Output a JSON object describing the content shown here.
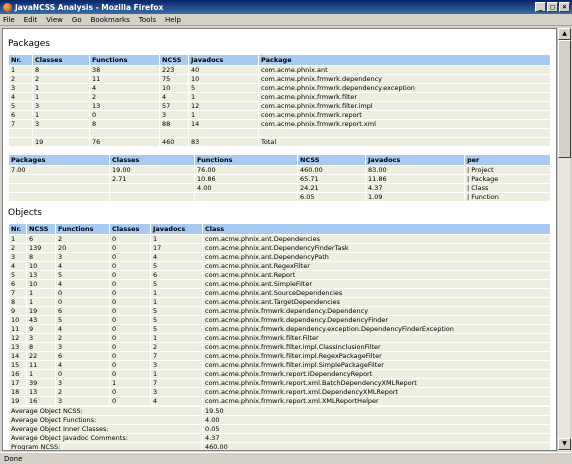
{
  "window": {
    "title": "JavaNCSS Analysis - Mozilla Firefox",
    "minimize": "_",
    "maximize": "□",
    "close": "×"
  },
  "menu": [
    "File",
    "Edit",
    "View",
    "Go",
    "Bookmarks",
    "Tools",
    "Help"
  ],
  "status": "Done",
  "packages": {
    "heading": "Packages",
    "columns": [
      "Nr.",
      "Classes",
      "Functions",
      "NCSS",
      "Javadocs",
      "Package"
    ],
    "rows": [
      [
        "1",
        "8",
        "38",
        "223",
        "40",
        "com.acme.phnix.ant"
      ],
      [
        "2",
        "2",
        "11",
        "75",
        "10",
        "com.acme.phnix.frmwrk.dependency"
      ],
      [
        "3",
        "1",
        "4",
        "10",
        "5",
        "com.acme.phnix.frmwrk.dependency.exception"
      ],
      [
        "4",
        "1",
        "2",
        "4",
        "1",
        "com.acme.phnix.frmwrk.filter"
      ],
      [
        "5",
        "3",
        "13",
        "57",
        "12",
        "com.acme.phnix.frmwrk.filter.impl"
      ],
      [
        "6",
        "1",
        "0",
        "3",
        "1",
        "com.acme.phnix.frmwrk.report"
      ],
      [
        "7",
        "3",
        "8",
        "88",
        "14",
        "com.acme.phnix.frmwrk.report.xml"
      ]
    ],
    "total": [
      "",
      "19",
      "76",
      "460",
      "83",
      "Total"
    ]
  },
  "averages": {
    "columns": [
      "Packages",
      "Classes",
      "Functions",
      "NCSS",
      "Javadocs",
      "per"
    ],
    "rows": [
      [
        "7.00",
        "19.00",
        "76.00",
        "460.00",
        "83.00",
        "Project"
      ],
      [
        "",
        "2.71",
        "10.86",
        "65.71",
        "11.86",
        "Package"
      ],
      [
        "",
        "",
        "4.00",
        "24.21",
        "4.37",
        "Class"
      ],
      [
        "",
        "",
        "",
        "6.05",
        "1.09",
        "Function"
      ]
    ]
  },
  "objects": {
    "heading": "Objects",
    "columns": [
      "Nr.",
      "NCSS",
      "Functions",
      "Classes",
      "Javadocs",
      "Class"
    ],
    "rows": [
      [
        "1",
        "6",
        "2",
        "0",
        "1",
        "com.acme.phnix.ant.Dependencies"
      ],
      [
        "2",
        "139",
        "20",
        "0",
        "17",
        "com.acme.phnix.ant.DependencyFinderTask"
      ],
      [
        "3",
        "8",
        "3",
        "0",
        "4",
        "com.acme.phnix.ant.DependencyPath"
      ],
      [
        "4",
        "10",
        "4",
        "0",
        "5",
        "com.acme.phnix.ant.RegexFilter"
      ],
      [
        "5",
        "13",
        "5",
        "0",
        "6",
        "com.acme.phnix.ant.Report"
      ],
      [
        "6",
        "10",
        "4",
        "0",
        "5",
        "com.acme.phnix.ant.SimpleFilter"
      ],
      [
        "7",
        "1",
        "0",
        "0",
        "1",
        "com.acme.phnix.ant.SourceDependencies"
      ],
      [
        "8",
        "1",
        "0",
        "0",
        "1",
        "com.acme.phnix.ant.TargetDependencies"
      ],
      [
        "9",
        "19",
        "6",
        "0",
        "5",
        "com.acme.phnix.frmwrk.dependency.Dependency"
      ],
      [
        "10",
        "43",
        "5",
        "0",
        "5",
        "com.acme.phnix.frmwrk.dependency.DependencyFinder"
      ],
      [
        "11",
        "9",
        "4",
        "0",
        "5",
        "com.acme.phnix.frmwrk.dependency.exception.DependencyFinderException"
      ],
      [
        "12",
        "3",
        "2",
        "0",
        "1",
        "com.acme.phnix.frmwrk.filter.Filter"
      ],
      [
        "13",
        "8",
        "3",
        "0",
        "2",
        "com.acme.phnix.frmwrk.filter.impl.ClassInclusionFilter"
      ],
      [
        "14",
        "22",
        "6",
        "0",
        "7",
        "com.acme.phnix.frmwrk.filter.impl.RegexPackageFilter"
      ],
      [
        "15",
        "11",
        "4",
        "0",
        "3",
        "com.acme.phnix.frmwrk.filter.impl.SimplePackageFilter"
      ],
      [
        "16",
        "1",
        "0",
        "0",
        "1",
        "com.acme.phnix.frmwrk.report.IDependencyReport"
      ],
      [
        "17",
        "39",
        "3",
        "1",
        "7",
        "com.acme.phnix.frmwrk.report.xml.BatchDependencyXMLReport"
      ],
      [
        "18",
        "13",
        "2",
        "0",
        "3",
        "com.acme.phnix.frmwrk.report.xml.DependencyXMLReport"
      ],
      [
        "19",
        "16",
        "3",
        "0",
        "4",
        "com.acme.phnix.frmwrk.report.xml.XMLReportHelper"
      ]
    ],
    "summary": [
      [
        "Average Object NCSS:",
        "19.50"
      ],
      [
        "Average Object Functions:",
        "4.00"
      ],
      [
        "Average Object Inner Classes:",
        "0.05"
      ],
      [
        "Average Object Javadoc Comments:",
        "4.37"
      ],
      [
        "Program NCSS:",
        "460.00"
      ]
    ]
  }
}
